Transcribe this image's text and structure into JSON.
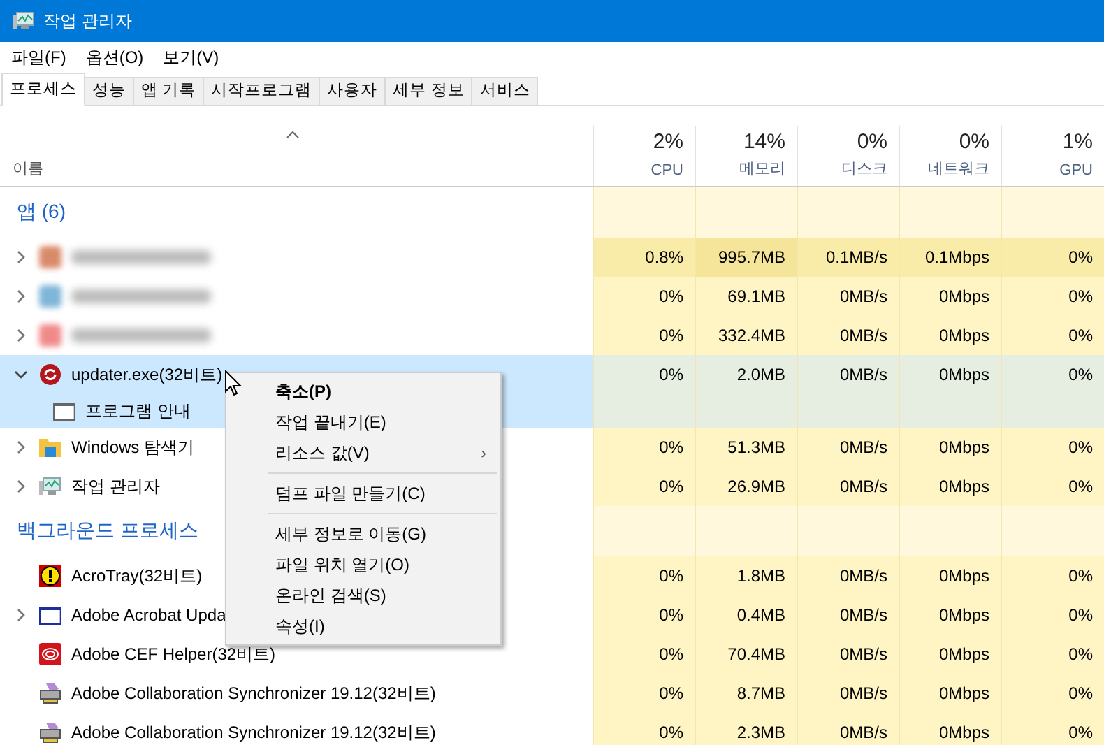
{
  "window": {
    "title": "작업 관리자"
  },
  "menu": [
    "파일(F)",
    "옵션(O)",
    "보기(V)"
  ],
  "tabs": [
    {
      "label": "프로세스",
      "selected": true
    },
    {
      "label": "성능",
      "selected": false
    },
    {
      "label": "앱 기록",
      "selected": false
    },
    {
      "label": "시작프로그램",
      "selected": false
    },
    {
      "label": "사용자",
      "selected": false
    },
    {
      "label": "세부 정보",
      "selected": false
    },
    {
      "label": "서비스",
      "selected": false
    }
  ],
  "columns": [
    {
      "label": "이름"
    },
    {
      "percent": "2%",
      "label": "CPU"
    },
    {
      "percent": "14%",
      "label": "메모리"
    },
    {
      "percent": "0%",
      "label": "디스크"
    },
    {
      "percent": "0%",
      "label": "네트워크"
    },
    {
      "percent": "1%",
      "label": "GPU"
    }
  ],
  "rows": [
    {
      "kind": "section",
      "name": "앱 (6)"
    },
    {
      "kind": "process",
      "blurred": true,
      "expanded": false,
      "selected": false,
      "hot": true,
      "values": [
        "0.8%",
        "995.7MB",
        "0.1MB/s",
        "0.1Mbps",
        "0%"
      ]
    },
    {
      "kind": "process",
      "blurred": true,
      "expanded": false,
      "selected": false,
      "hot": false,
      "values": [
        "0%",
        "69.1MB",
        "0MB/s",
        "0Mbps",
        "0%"
      ]
    },
    {
      "kind": "process",
      "blurred": true,
      "expanded": false,
      "selected": false,
      "hot": false,
      "values": [
        "0%",
        "332.4MB",
        "0MB/s",
        "0Mbps",
        "0%"
      ]
    },
    {
      "kind": "process",
      "name": "updater.exe(32비트)",
      "expanded": true,
      "selected": true,
      "hot": false,
      "values": [
        "0%",
        "2.0MB",
        "0MB/s",
        "0Mbps",
        "0%"
      ]
    },
    {
      "kind": "child",
      "name": "프로그램 안내",
      "selected": true
    },
    {
      "kind": "process",
      "name": "Windows 탐색기",
      "expanded": false,
      "selected": false,
      "hot": false,
      "values": [
        "0%",
        "51.3MB",
        "0MB/s",
        "0Mbps",
        "0%"
      ]
    },
    {
      "kind": "process",
      "name": "작업 관리자",
      "expanded": false,
      "selected": false,
      "hot": false,
      "values": [
        "0%",
        "26.9MB",
        "0MB/s",
        "0Mbps",
        "0%"
      ]
    },
    {
      "kind": "section",
      "name": "백그라운드 프로세스"
    },
    {
      "kind": "process",
      "name": "AcroTray(32비트)",
      "selected": false,
      "hot": false,
      "values": [
        "0%",
        "1.8MB",
        "0MB/s",
        "0Mbps",
        "0%"
      ]
    },
    {
      "kind": "process",
      "name": "Adobe Acrobat Upda",
      "expanded": false,
      "selected": false,
      "hot": false,
      "values": [
        "0%",
        "0.4MB",
        "0MB/s",
        "0Mbps",
        "0%"
      ]
    },
    {
      "kind": "process",
      "name": "Adobe CEF Helper(32비트)",
      "selected": false,
      "hot": false,
      "values": [
        "0%",
        "70.4MB",
        "0MB/s",
        "0Mbps",
        "0%"
      ]
    },
    {
      "kind": "process",
      "name": "Adobe Collaboration Synchronizer 19.12(32비트)",
      "selected": false,
      "hot": false,
      "values": [
        "0%",
        "8.7MB",
        "0MB/s",
        "0Mbps",
        "0%"
      ]
    },
    {
      "kind": "process",
      "name": "Adobe Collaboration Synchronizer 19.12(32비트)",
      "selected": false,
      "hot": false,
      "values": [
        "0%",
        "2.3MB",
        "0MB/s",
        "0Mbps",
        "0%"
      ]
    }
  ],
  "context_menu": [
    {
      "kind": "item",
      "label": "축소(P)",
      "default": true
    },
    {
      "kind": "item",
      "label": "작업 끝내기(E)",
      "default": false
    },
    {
      "kind": "submenu",
      "label": "리소스 값(V)",
      "arrow": "›",
      "default": false
    },
    {
      "kind": "separator"
    },
    {
      "kind": "item",
      "label": "덤프 파일 만들기(C)",
      "default": false
    },
    {
      "kind": "separator"
    },
    {
      "kind": "item",
      "label": "세부 정보로 이동(G)",
      "default": false
    },
    {
      "kind": "item",
      "label": "파일 위치 열기(O)",
      "default": false
    },
    {
      "kind": "item",
      "label": "온라인 검색(S)",
      "default": false
    },
    {
      "kind": "item",
      "label": "속성(I)",
      "default": false
    }
  ]
}
